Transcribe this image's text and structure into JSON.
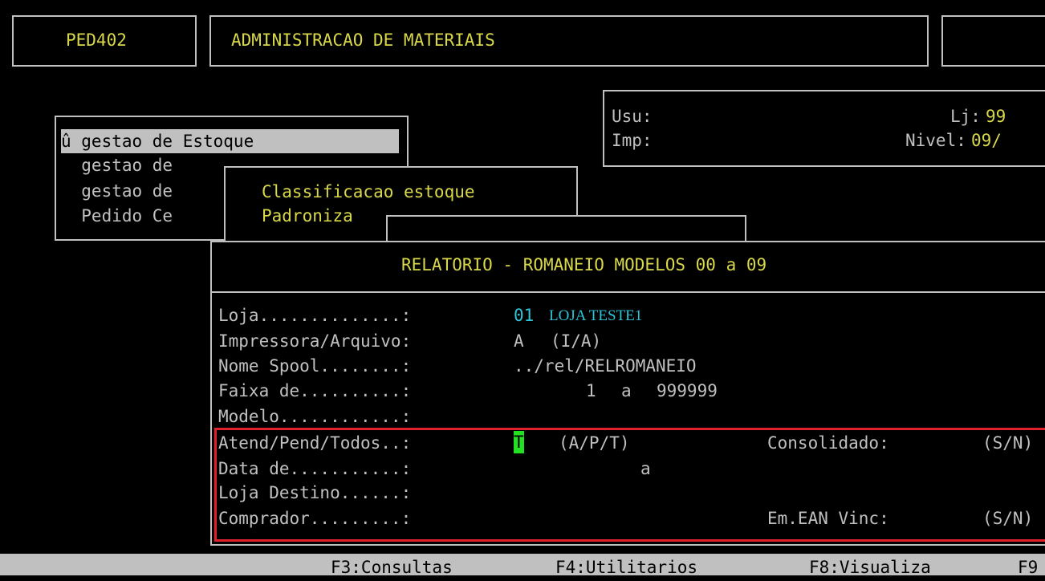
{
  "header": {
    "program_code": "PED402",
    "title": "ADMINISTRACAO DE MATERIAIS"
  },
  "info_box": {
    "user_label": "Usu:",
    "store_label": "Lj:",
    "store_value": "99",
    "printer_label": "Imp:",
    "level_label": "Nivel:",
    "level_value": "09/"
  },
  "menu": {
    "items": [
      "û gestao de Estoque",
      "  gestao de",
      "  gestao de",
      "  Pedido Ce"
    ]
  },
  "submenu": {
    "items": [
      "Classificacao estoque",
      "Padroniza"
    ]
  },
  "report": {
    "title": "RELATORIO - ROMANEIO MODELOS 00 a 09",
    "fields": {
      "loja_label": "Loja..............:",
      "loja_code": "01",
      "loja_name": "LOJA TESTE1",
      "printer_label": "Impressora/Arquivo:",
      "printer_value": "A",
      "printer_options": "(I/A)",
      "spool_label": "Nome Spool........:",
      "spool_value": "../rel/RELROMANEIO",
      "range_label": "Faixa de..........:",
      "range_from": "1",
      "range_sep": "a",
      "range_to": "999999",
      "model_label": "Modelo............:",
      "status_label": "Atend/Pend/Todos..:",
      "status_value": "T",
      "status_options": "(A/P/T)",
      "consolidated_label": "Consolidado:",
      "consolidated_options": "(S/N)",
      "date_label": "Data de...........:",
      "date_sep": "a",
      "dest_label": "Loja Destino......:",
      "buyer_label": "Comprador.........:",
      "ean_label": "Em.EAN Vinc:",
      "ean_options": "(S/N)"
    }
  },
  "function_keys": [
    "F3:Consultas",
    "F4:Utilitarios",
    "F8:Visualiza",
    "F9"
  ],
  "colors": {
    "background": "#000000",
    "text": "#c0c0c0",
    "label_yellow": "#d8d84a",
    "value_cyan": "#2ec4d8",
    "cursor": "#22e022",
    "highlight_border": "#e0202a"
  }
}
